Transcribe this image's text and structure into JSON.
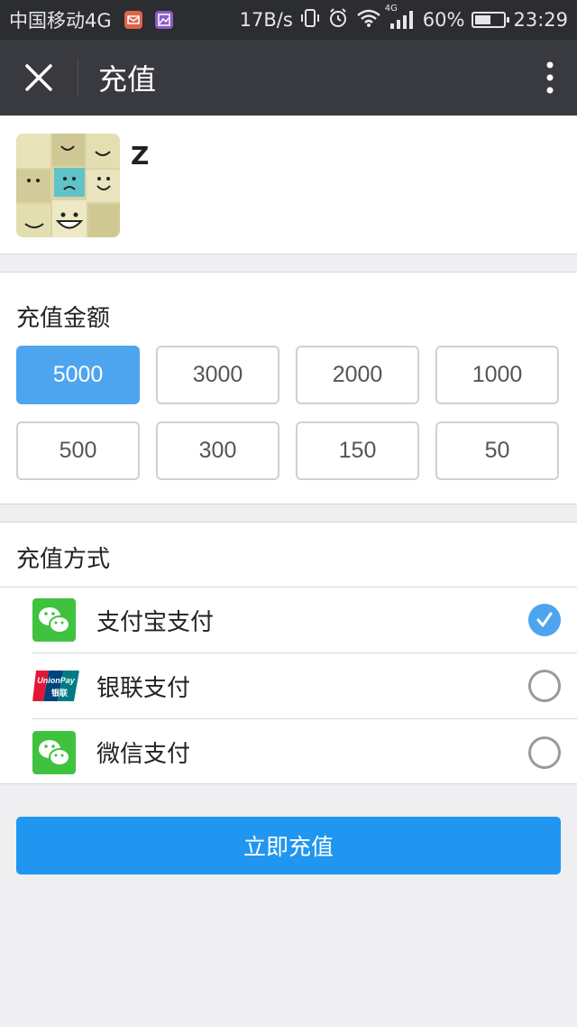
{
  "status_bar": {
    "carrier": "中国移动4G",
    "speed": "17B/s",
    "network": "4G",
    "battery_percent": "60%",
    "battery_level": 0.6,
    "time": "23:29",
    "colors": {
      "mail_icon": "#e0624a",
      "gallery_icon": "#8b5cc4"
    }
  },
  "nav": {
    "title": "充值"
  },
  "profile": {
    "username": "Z",
    "avatar_icon": "sticky-notes-faces-image"
  },
  "amount": {
    "title": "充值金额",
    "options": [
      "5000",
      "3000",
      "2000",
      "1000",
      "500",
      "300",
      "150",
      "50"
    ],
    "selected": "5000"
  },
  "method": {
    "title": "充值方式",
    "items": [
      {
        "label": "支付宝支付",
        "icon": "wechat-icon",
        "checked": true
      },
      {
        "label": "银联支付",
        "icon": "unionpay-icon",
        "checked": false
      },
      {
        "label": "微信支付",
        "icon": "wechat-icon",
        "checked": false
      }
    ],
    "unionpay_text": "UnionPay",
    "unionpay_cn": "银联"
  },
  "submit": {
    "label": "立即充值"
  },
  "colors": {
    "accent": "#4ea5ef",
    "submit": "#2196f0",
    "nav": "#393a3f",
    "status": "#2b2d30",
    "wechat": "#3fc23e"
  }
}
